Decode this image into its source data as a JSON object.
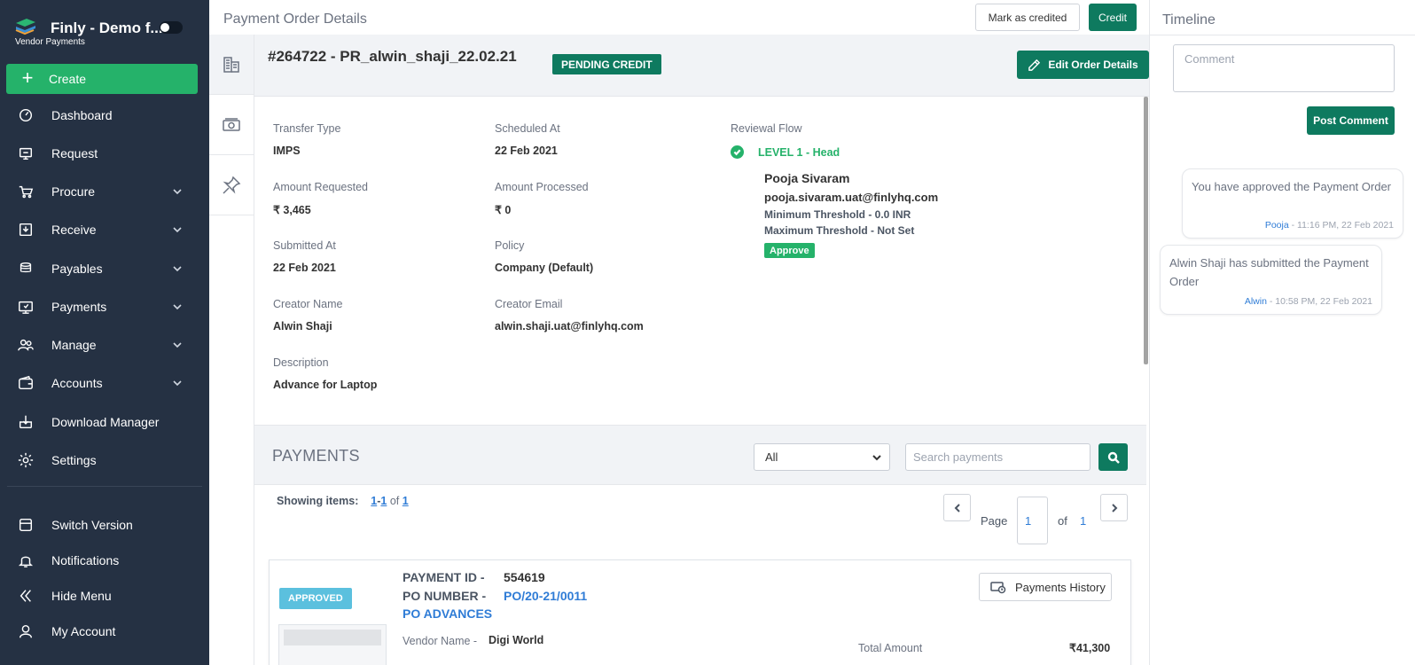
{
  "brand": {
    "title": "Finly - Demo f...",
    "subtitle": "Vendor Payments"
  },
  "sidebar": {
    "create_label": "Create",
    "items": [
      {
        "label": "Dashboard",
        "icon": "dashboard-icon",
        "has_chevron": false
      },
      {
        "label": "Request",
        "icon": "request-icon",
        "has_chevron": false
      },
      {
        "label": "Procure",
        "icon": "procure-icon",
        "has_chevron": true
      },
      {
        "label": "Receive",
        "icon": "receive-icon",
        "has_chevron": true
      },
      {
        "label": "Payables",
        "icon": "payables-icon",
        "has_chevron": true
      },
      {
        "label": "Payments",
        "icon": "payments-icon",
        "has_chevron": true
      },
      {
        "label": "Manage",
        "icon": "manage-icon",
        "has_chevron": true
      },
      {
        "label": "Accounts",
        "icon": "accounts-icon",
        "has_chevron": true
      },
      {
        "label": "Download Manager",
        "icon": "download-manager-icon",
        "has_chevron": false
      },
      {
        "label": "Settings",
        "icon": "settings-icon",
        "has_chevron": false
      }
    ],
    "bottom_items": [
      {
        "label": "Switch Version",
        "icon": "switch-version-icon"
      },
      {
        "label": "Notifications",
        "icon": "bell-icon"
      },
      {
        "label": "Hide Menu",
        "icon": "double-chevron-left-icon"
      },
      {
        "label": "My Account",
        "icon": "user-icon"
      }
    ]
  },
  "header": {
    "title": "Payment Order Details",
    "mark_credited_label": "Mark as credited",
    "credit_label": "Credit"
  },
  "order": {
    "id": "#264722  -  PR_alwin_shaji_22.02.21",
    "status": "PENDING CREDIT",
    "edit_label": "Edit Order Details"
  },
  "details": {
    "transfer_type": {
      "label": "Transfer Type",
      "value": "IMPS"
    },
    "scheduled_at": {
      "label": "Scheduled At",
      "value": "22 Feb 2021"
    },
    "amount_requested": {
      "label": "Amount Requested",
      "value": "₹ 3,465"
    },
    "amount_processed": {
      "label": "Amount Processed",
      "value": "₹ 0"
    },
    "submitted_at": {
      "label": "Submitted At",
      "value": "22 Feb 2021"
    },
    "policy": {
      "label": "Policy",
      "value": "Company (Default)"
    },
    "creator_name": {
      "label": "Creator Name",
      "value": "Alwin Shaji"
    },
    "creator_email": {
      "label": "Creator Email",
      "value": "alwin.shaji.uat@finlyhq.com"
    },
    "description": {
      "label": "Description",
      "value": "Advance for Laptop"
    }
  },
  "review": {
    "label": "Reviewal Flow",
    "level": "LEVEL 1  -   Head",
    "approver_name": "Pooja Sivaram",
    "approver_email": "pooja.sivaram.uat@finlyhq.com",
    "min_threshold": "Minimum Threshold -   0.0 INR",
    "max_threshold": "Maximum Threshold -   Not Set",
    "approve_badge": "Approve"
  },
  "payments": {
    "title": "PAYMENTS",
    "filter_selected": "All",
    "search_placeholder": "Search payments",
    "showing_label": "Showing items:",
    "showing_range_a": "1",
    "showing_range_b": "1",
    "showing_of": "of",
    "showing_total": "1",
    "page_label": "Page",
    "page_current": "1",
    "page_of": "of",
    "page_total": "1"
  },
  "payment_card": {
    "status": "APPROVED",
    "payment_id_label": "PAYMENT ID  -",
    "payment_id": "554619",
    "po_number_label": "PO NUMBER  -",
    "po_number": "PO/20-21/0011",
    "po_type": "PO ADVANCES",
    "vendor_label": "Vendor Name  -",
    "vendor_name": "Digi World",
    "total_label": "Total Amount",
    "total_value": "₹41,300",
    "history_label": "Payments History"
  },
  "timeline": {
    "title": "Timeline",
    "comment_placeholder": "Comment",
    "post_label": "Post Comment",
    "entries": [
      {
        "message": "You have approved the Payment Order",
        "who": "Pooja",
        "when": " - 11:16 PM, 22 Feb 2021"
      },
      {
        "message": "Alwin Shaji has submitted the Payment Order",
        "who": "Alwin",
        "when": " - 10:58 PM, 22 Feb 2021"
      }
    ]
  },
  "colors": {
    "sidebar_bg": "#253143",
    "create_green": "#25b26a",
    "primary_green": "#0e7a5f",
    "link_blue": "#2f7cd6",
    "approved_blue": "#5bc0de"
  }
}
